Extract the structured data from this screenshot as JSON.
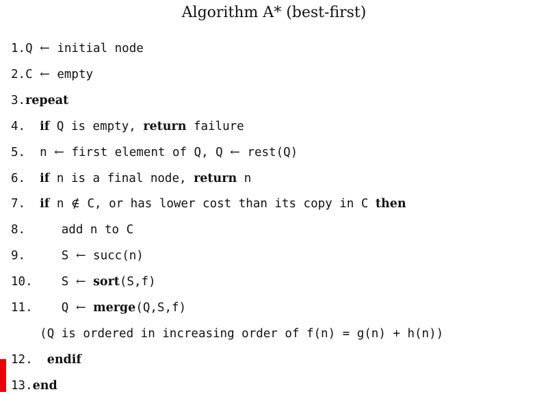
{
  "title": "Algorithm A* (best-first)",
  "accent_color": "#e8000b",
  "lines": [
    {
      "number": "1.",
      "indent": "",
      "segments": [
        {
          "type": "code",
          "text": "Q "
        },
        {
          "type": "op",
          "text": "←"
        },
        {
          "type": "code",
          "text": " initial node"
        }
      ]
    },
    {
      "number": "2.",
      "indent": "",
      "segments": [
        {
          "type": "code",
          "text": "C "
        },
        {
          "type": "op",
          "text": "←"
        },
        {
          "type": "code",
          "text": " empty"
        }
      ]
    },
    {
      "number": "3.",
      "indent": "",
      "segments": [
        {
          "type": "kw",
          "text": "repeat"
        }
      ]
    },
    {
      "number": "4.",
      "indent": "  ",
      "segments": [
        {
          "type": "kw",
          "text": "if"
        },
        {
          "type": "code",
          "text": " Q is empty, "
        },
        {
          "type": "kw",
          "text": "return"
        },
        {
          "type": "code",
          "text": " failure"
        }
      ]
    },
    {
      "number": "5.",
      "indent": "  ",
      "segments": [
        {
          "type": "code",
          "text": "n "
        },
        {
          "type": "op",
          "text": "←"
        },
        {
          "type": "code",
          "text": " first element of Q, Q "
        },
        {
          "type": "op",
          "text": "←"
        },
        {
          "type": "code",
          "text": " rest(Q)"
        }
      ]
    },
    {
      "number": "6.",
      "indent": "  ",
      "segments": [
        {
          "type": "kw",
          "text": "if"
        },
        {
          "type": "code",
          "text": " n is a final node, "
        },
        {
          "type": "kw",
          "text": "return"
        },
        {
          "type": "code",
          "text": " n"
        }
      ]
    },
    {
      "number": "7.",
      "indent": "  ",
      "segments": [
        {
          "type": "kw",
          "text": "if"
        },
        {
          "type": "code",
          "text": " n "
        },
        {
          "type": "op",
          "text": "∉"
        },
        {
          "type": "code",
          "text": " C, or has lower cost than its copy in C "
        },
        {
          "type": "kw",
          "text": "then"
        }
      ]
    },
    {
      "number": "8.",
      "indent": "     ",
      "segments": [
        {
          "type": "code",
          "text": "add n to C"
        }
      ]
    },
    {
      "number": "9.",
      "indent": "     ",
      "segments": [
        {
          "type": "code",
          "text": "S "
        },
        {
          "type": "op",
          "text": "←"
        },
        {
          "type": "code",
          "text": " succ(n)"
        }
      ]
    },
    {
      "number": "10.",
      "indent": "    ",
      "segments": [
        {
          "type": "code",
          "text": "S "
        },
        {
          "type": "op",
          "text": "←"
        },
        {
          "type": "code",
          "text": " "
        },
        {
          "type": "kw",
          "text": "sort"
        },
        {
          "type": "code",
          "text": "(S,f)"
        }
      ]
    },
    {
      "number": "11.",
      "indent": "    ",
      "segments": [
        {
          "type": "code",
          "text": "Q "
        },
        {
          "type": "op",
          "text": "←"
        },
        {
          "type": "code",
          "text": " "
        },
        {
          "type": "kw",
          "text": "merge"
        },
        {
          "type": "code",
          "text": "(Q,S,f)"
        }
      ]
    },
    {
      "number": "",
      "indent": "    ",
      "segments": [
        {
          "type": "code",
          "text": "(Q is ordered in increasing order of f(n) = g(n) + h(n))"
        }
      ]
    },
    {
      "number": "12.",
      "indent": "  ",
      "segments": [
        {
          "type": "kw",
          "text": "endif"
        }
      ]
    },
    {
      "number": "13.",
      "indent": "",
      "segments": [
        {
          "type": "kw",
          "text": "end"
        }
      ]
    }
  ]
}
